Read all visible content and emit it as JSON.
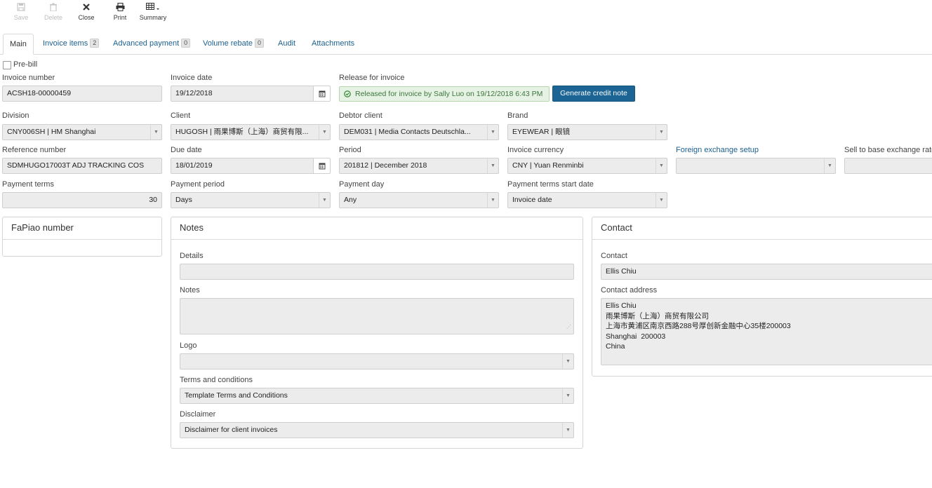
{
  "toolbar": {
    "save": "Save",
    "delete": "Delete",
    "close": "Close",
    "print": "Print",
    "summary": "Summary"
  },
  "tabs": [
    {
      "label": "Main"
    },
    {
      "label": "Invoice items",
      "badge": "2"
    },
    {
      "label": "Advanced payment",
      "badge": "0"
    },
    {
      "label": "Volume rebate",
      "badge": "0"
    },
    {
      "label": "Audit"
    },
    {
      "label": "Attachments"
    }
  ],
  "form": {
    "prebill_label": "Pre-bill",
    "prebill_checked": false,
    "invoice_number": {
      "label": "Invoice number",
      "value": "ACSH18-00000459"
    },
    "invoice_date": {
      "label": "Invoice date",
      "value": "19/12/2018"
    },
    "release": {
      "label": "Release for invoice",
      "status": "Released for invoice by Sally Luo on 19/12/2018 6:43 PM",
      "button": "Generate credit note"
    },
    "division": {
      "label": "Division",
      "value": "CNY006SH | HM Shanghai"
    },
    "client": {
      "label": "Client",
      "value": "HUGOSH | 雨果博斯（上海）商贸有限..."
    },
    "debtor_client": {
      "label": "Debtor client",
      "value": "DEM031 | Media Contacts Deutschla..."
    },
    "brand": {
      "label": "Brand",
      "value": "EYEWEAR | 眼镜"
    },
    "reference_number": {
      "label": "Reference number",
      "value": "SDMHUGO17003T ADJ TRACKING COS"
    },
    "due_date": {
      "label": "Due date",
      "value": "18/01/2019"
    },
    "period": {
      "label": "Period",
      "value": "201812 | December 2018"
    },
    "invoice_currency": {
      "label": "Invoice currency",
      "value": "CNY | Yuan Renminbi"
    },
    "fx_setup": {
      "label": "Foreign exchange setup",
      "value": ""
    },
    "sell_to_base": {
      "label": "Sell to base exchange rate",
      "value": ""
    },
    "payment_terms": {
      "label": "Payment terms",
      "value": "30"
    },
    "payment_period": {
      "label": "Payment period",
      "value": "Days"
    },
    "payment_day": {
      "label": "Payment day",
      "value": "Any"
    },
    "payment_terms_start": {
      "label": "Payment terms start date",
      "value": "Invoice date"
    }
  },
  "fapiao": {
    "title": "FaPiao number"
  },
  "notes": {
    "title": "Notes",
    "details": {
      "label": "Details",
      "value": ""
    },
    "notes": {
      "label": "Notes",
      "value": ""
    },
    "logo": {
      "label": "Logo",
      "value": ""
    },
    "terms": {
      "label": "Terms and conditions",
      "value": "Template Terms and Conditions"
    },
    "disclaimer": {
      "label": "Disclaimer",
      "value": "Disclaimer for client invoices"
    }
  },
  "contact": {
    "title": "Contact",
    "contact_label": "Contact",
    "contact_value": "Ellis Chiu",
    "address_label": "Contact address",
    "address_lines": [
      "Ellis Chiu",
      "雨果博斯（上海）商贸有限公司",
      "上海市黄浦区南京西路288号厚创新金融中心35楼200003",
      "Shanghai  200003",
      "China"
    ]
  }
}
